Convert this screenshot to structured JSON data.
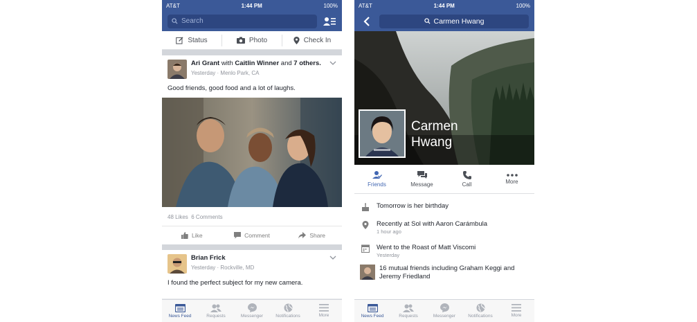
{
  "status_bar": {
    "carrier": "AT&T",
    "time": "1:44 PM",
    "battery": "100%"
  },
  "feed": {
    "search_placeholder": "Search",
    "composer": {
      "status": "Status",
      "photo": "Photo",
      "checkin": "Check In"
    },
    "post1": {
      "author": "Ari Grant",
      "with_word": "with",
      "tagged": "Caitlin Winner",
      "and_word": "and",
      "others": "7 others.",
      "time": "Yesterday",
      "location": "Menlo Park, CA",
      "text": "Good friends, good food and a lot of laughs.",
      "likes": "48 Likes",
      "comments": "6 Comments",
      "actions": {
        "like": "Like",
        "comment": "Comment",
        "share": "Share"
      }
    },
    "post2": {
      "author": "Brian Frick",
      "time": "Yesterday",
      "location": "Rockville, MD",
      "text": "I found the perfect subject for my new camera."
    }
  },
  "tabs": [
    {
      "label": "News Feed",
      "icon": "news-feed-icon"
    },
    {
      "label": "Requests",
      "icon": "requests-icon"
    },
    {
      "label": "Messenger",
      "icon": "messenger-icon"
    },
    {
      "label": "Notifications",
      "icon": "globe-icon"
    },
    {
      "label": "More",
      "icon": "menu-icon"
    }
  ],
  "profile": {
    "search_text": "Carmen Hwang",
    "name_first": "Carmen",
    "name_last": "Hwang",
    "actions": {
      "friends": "Friends",
      "message": "Message",
      "call": "Call",
      "more": "More"
    },
    "info": [
      {
        "main": "Tomorrow is her birthday",
        "sub": "",
        "icon": "cake-icon"
      },
      {
        "main": "Recently at Sol with Aaron Carámbula",
        "sub": "1 hour ago",
        "icon": "location-pin-icon"
      },
      {
        "main": "Went to the Roast of Matt Viscomi",
        "sub": "Yesterday",
        "icon": "calendar-icon"
      },
      {
        "main": "16 mutual friends including Graham Keggi and Jeremy Friedland",
        "sub": "",
        "icon": "mutual-friend-avatar"
      }
    ]
  },
  "colors": {
    "brand": "#3b5998",
    "active_blue": "#4267b2",
    "grey_text": "#90949c"
  }
}
